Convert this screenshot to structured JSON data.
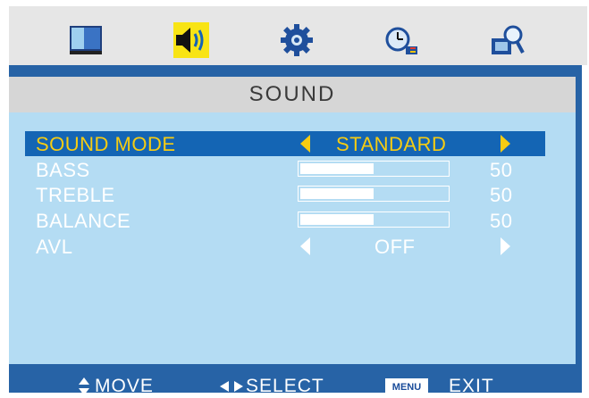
{
  "tabs": [
    {
      "icon": "monitor-icon",
      "selected": false
    },
    {
      "icon": "speaker-icon",
      "selected": true
    },
    {
      "icon": "gear-icon",
      "selected": false
    },
    {
      "icon": "clock-icon",
      "selected": false
    },
    {
      "icon": "magnifier-icon",
      "selected": false
    }
  ],
  "title": "SOUND",
  "items": [
    {
      "label": "SOUND MODE",
      "value": "STANDARD"
    },
    {
      "label": "BASS",
      "value": 50
    },
    {
      "label": "TREBLE",
      "value": 50
    },
    {
      "label": "BALANCE",
      "value": 50
    },
    {
      "label": "AVL",
      "value": "OFF"
    }
  ],
  "footer": {
    "move": "MOVE",
    "select": "SELECT",
    "menu": "MENU",
    "exit": "EXIT"
  },
  "colors": {
    "frame": "#2763a6",
    "panel": "#b4dcf3",
    "highlight": "#1465b4",
    "highlight_text": "#f6cc12",
    "selected_tab": "#f8e415"
  }
}
